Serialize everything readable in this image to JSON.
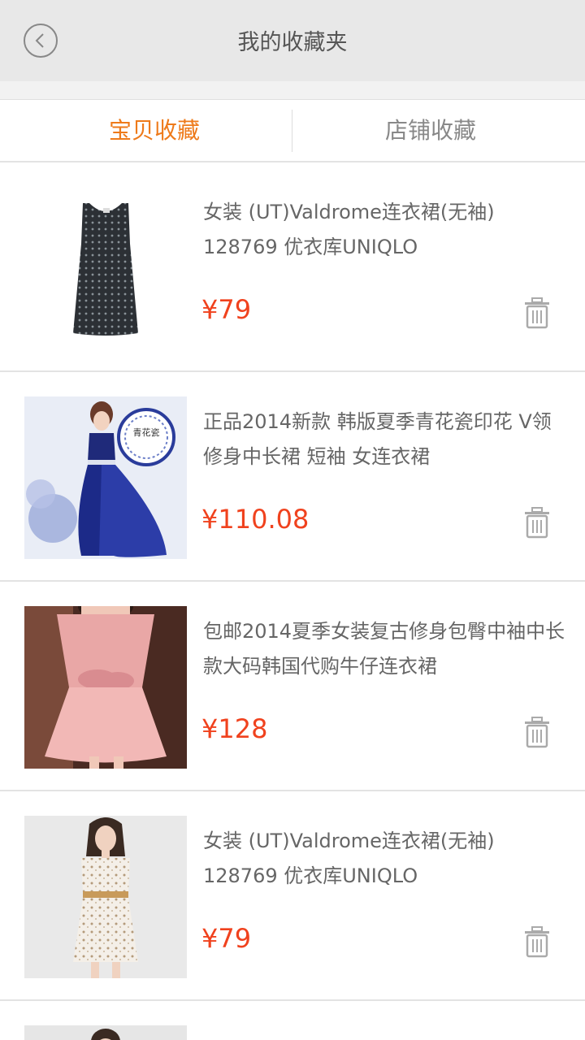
{
  "header": {
    "title": "我的收藏夹",
    "back_icon": "chevron-left-circle-icon"
  },
  "tabs": [
    {
      "label": "宝贝收藏",
      "active": true
    },
    {
      "label": "店铺收藏",
      "active": false
    }
  ],
  "colors": {
    "accent": "#ee7a1a",
    "price": "#f0421e",
    "header_bg": "#e8e8e8"
  },
  "items": [
    {
      "title": "女装 (UT)Valdrome连衣裙(无袖) 128769 优衣库UNIQLO",
      "price": "¥79",
      "image": "dark-polka-dot-sleeveless-dress"
    },
    {
      "title": "正品2014新款  韩版夏季青花瓷印花 V领修身中长裙 短袖 女连衣裙",
      "price": "¥110.08",
      "image": "blue-white-porcelain-print-dress",
      "image_text": "青花瓷"
    },
    {
      "title": "包邮2014夏季女装复古修身包臀中袖中长款大码韩国代购牛仔连衣裙",
      "price": "¥128",
      "image": "pink-bow-dress"
    },
    {
      "title": "女装 (UT)Valdrome连衣裙(无袖) 128769 优衣库UNIQLO",
      "price": "¥79",
      "image": "white-floral-dress-belt"
    }
  ]
}
